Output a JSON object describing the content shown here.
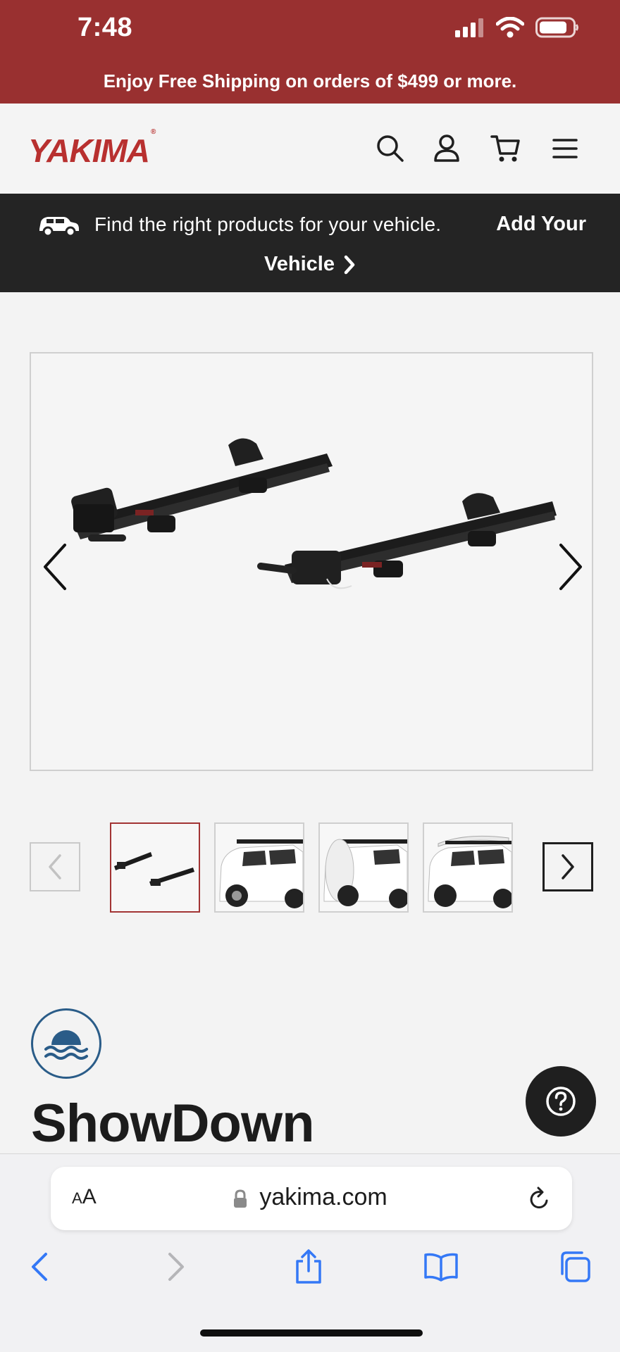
{
  "status_bar": {
    "time": "7:48"
  },
  "promo": {
    "text": "Enjoy Free Shipping on orders of $499 or more."
  },
  "header": {
    "logo_text": "YAKIMA",
    "logo_mark": "®",
    "icons": [
      "search-icon",
      "account-icon",
      "cart-icon",
      "menu-icon"
    ]
  },
  "vehicle_bar": {
    "prompt": "Find the right products for your vehicle.",
    "cta_line1": "Add Your",
    "cta_line2": "Vehicle"
  },
  "gallery": {
    "main_image_alt": "ShowDown rack product image",
    "thumbnails": [
      {
        "label": "rack-pair",
        "active": true
      },
      {
        "label": "vehicle-rear-view",
        "active": false
      },
      {
        "label": "vehicle-with-board-side",
        "active": false
      },
      {
        "label": "vehicle-with-board-roof",
        "active": false
      }
    ]
  },
  "product": {
    "title": "ShowDown"
  },
  "browser": {
    "aa_label_a": "A",
    "aa_label_b": "A",
    "url": "yakima.com"
  },
  "colors": {
    "brand_red": "#993030",
    "dark_bar": "#242424",
    "active_thumb_border": "#a23434",
    "badge_blue": "#2a5c88",
    "safari_blue": "#3478f6"
  }
}
